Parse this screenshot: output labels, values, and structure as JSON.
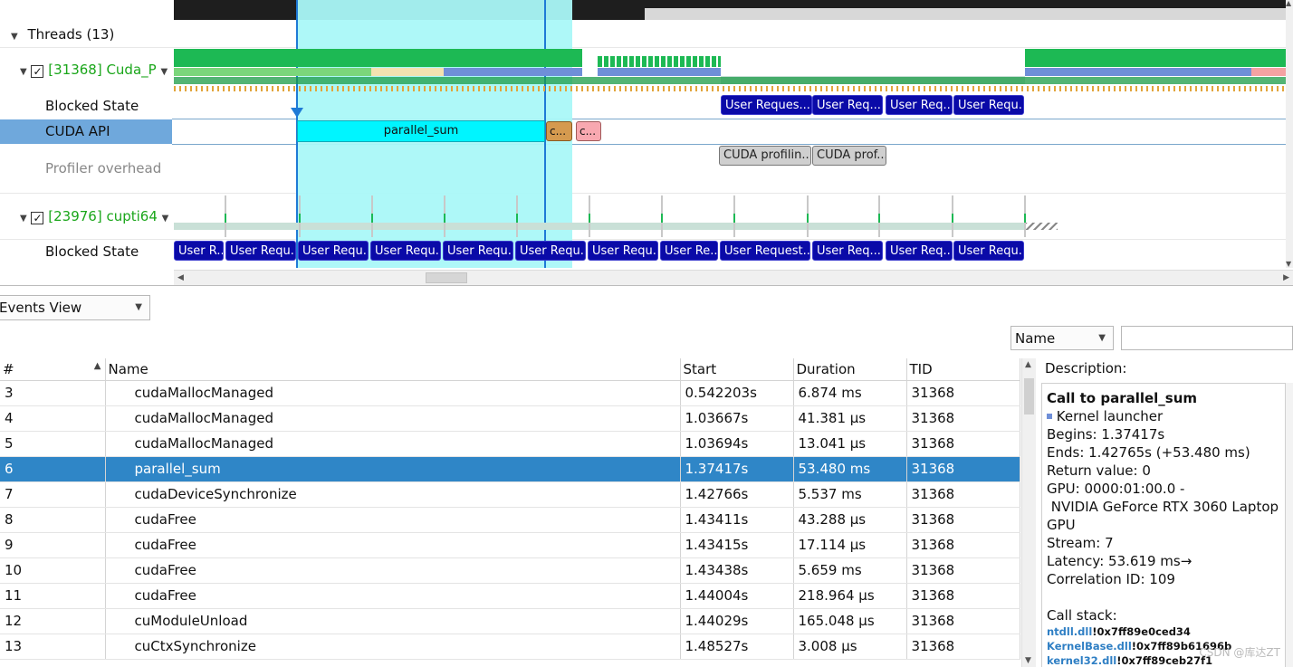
{
  "timeline": {
    "threads_label": "Threads (13)",
    "thread1": {
      "check": "✓",
      "label": "[31368] Cuda_P"
    },
    "thread2": {
      "check": "✓",
      "label": "[23976] cupti64"
    },
    "rows": {
      "blocked_state": "Blocked State",
      "cuda_api": "CUDA API",
      "profiler_overhead": "Profiler overhead",
      "blocked_state2": "Blocked State"
    },
    "cuda_api_blocks": {
      "main": "parallel_sum",
      "small1": "c...",
      "small2": "c..."
    },
    "thread1_blocked": [
      "User Reques...",
      "User Req...",
      "User Req...",
      "User Requ..."
    ],
    "profiler_blocks": [
      "CUDA profilin...",
      "CUDA prof..."
    ],
    "thread2_blocked": [
      "User R...",
      "User Requ...",
      "User Requ...",
      "User Requ...",
      "User Requ...",
      "User Requ...",
      "User Requ...",
      "User Re...",
      "User Request...",
      "User Req...",
      "User Req...",
      "User Requ..."
    ],
    "colors": {
      "selection": "#aaf8f8",
      "cuda_api_row": "#6fa8dc",
      "api_block": "#00f5ff",
      "green": "#1db954",
      "blocked": "#0a0aa8"
    }
  },
  "events": {
    "view_selector": "Events View",
    "filter_field": "Name",
    "search_value": "",
    "columns": [
      "#",
      "Name",
      "Start",
      "Duration",
      "TID"
    ],
    "rows": [
      [
        "3",
        "cudaMallocManaged",
        "0.542203s",
        "6.874 ms",
        "31368"
      ],
      [
        "4",
        "cudaMallocManaged",
        "1.03667s",
        "41.381 μs",
        "31368"
      ],
      [
        "5",
        "cudaMallocManaged",
        "1.03694s",
        "13.041 μs",
        "31368"
      ],
      [
        "6",
        "parallel_sum",
        "1.37417s",
        "53.480 ms",
        "31368"
      ],
      [
        "7",
        "cudaDeviceSynchronize",
        "1.42766s",
        "5.537 ms",
        "31368"
      ],
      [
        "8",
        "cudaFree",
        "1.43411s",
        "43.288 μs",
        "31368"
      ],
      [
        "9",
        "cudaFree",
        "1.43415s",
        "17.114 μs",
        "31368"
      ],
      [
        "10",
        "cudaFree",
        "1.43438s",
        "5.659 ms",
        "31368"
      ],
      [
        "11",
        "cudaFree",
        "1.44004s",
        "218.964 μs",
        "31368"
      ],
      [
        "12",
        "cuModuleUnload",
        "1.44029s",
        "165.048 μs",
        "31368"
      ],
      [
        "13",
        "cuCtxSynchronize",
        "1.48527s",
        "3.008 μs",
        "31368"
      ]
    ],
    "selected_row": 3
  },
  "description": {
    "header": "Description:",
    "title": "Call to parallel_sum",
    "kind": "Kernel launcher",
    "lines": [
      "Begins: 1.37417s",
      "Ends: 1.42765s (+53.480 ms)",
      "Return value: 0",
      "GPU: 0000:01:00.0 -",
      " NVIDIA GeForce RTX 3060 Laptop GPU",
      "Stream: 7",
      "Latency: 53.619 ms→",
      "Correlation ID: 109"
    ],
    "callstack_label": "Call stack:",
    "callstack": [
      {
        "module": "ntdll.dll",
        "addr": "!0x7ff89e0ced34"
      },
      {
        "module": "KernelBase.dll",
        "addr": "!0x7ff89b61696b"
      },
      {
        "module": "kernel32.dll",
        "addr": "!0x7ff89ceb27f1"
      }
    ]
  },
  "watermark": "CSDN @库达ZT"
}
